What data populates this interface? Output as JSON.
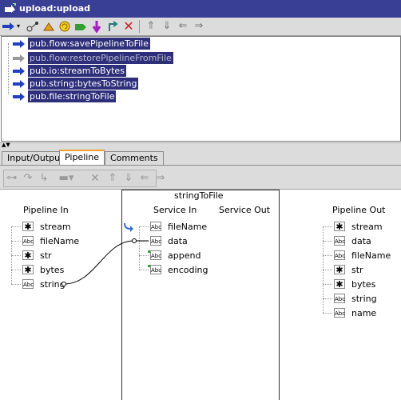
{
  "window": {
    "title": "upload:upload"
  },
  "toolbar_top": {
    "icons": [
      "step-in-icon",
      "dropdown-icon",
      "branch-icon",
      "repeat-icon",
      "loop-icon",
      "sequence-icon",
      "exit-icon",
      "down-icon",
      "exit-flow-icon",
      "delete-icon",
      "move-up-icon",
      "move-down-icon",
      "move-left-icon",
      "move-right-icon"
    ]
  },
  "flow": {
    "steps": [
      {
        "label": "pub.flow:savePipelineToFile",
        "disabled": false
      },
      {
        "label": "pub.flow:restorePipelineFromFile",
        "disabled": true
      },
      {
        "label": "pub.io:streamToBytes",
        "disabled": false
      },
      {
        "label": "pub.string:bytesToString",
        "disabled": false
      },
      {
        "label": "pub.file:stringToFile",
        "disabled": false
      }
    ]
  },
  "tabs": [
    {
      "label": "Input/Output",
      "active": false
    },
    {
      "label": "Pipeline",
      "active": true
    },
    {
      "label": "Comments",
      "active": false
    }
  ],
  "pipeline": {
    "service_name": "stringToFile",
    "pipeline_in_header": "Pipeline In",
    "service_in_header": "Service In",
    "service_out_header": "Service Out",
    "pipeline_out_header": "Pipeline Out",
    "pipeline_in": [
      {
        "name": "stream",
        "type": "object"
      },
      {
        "name": "fileName",
        "type": "string"
      },
      {
        "name": "str",
        "type": "object"
      },
      {
        "name": "bytes",
        "type": "object"
      },
      {
        "name": "string",
        "type": "string"
      }
    ],
    "service_in": [
      {
        "name": "fileName",
        "type": "string"
      },
      {
        "name": "data",
        "type": "string"
      },
      {
        "name": "append",
        "type": "string"
      },
      {
        "name": "encoding",
        "type": "string"
      }
    ],
    "pipeline_out": [
      {
        "name": "stream",
        "type": "object"
      },
      {
        "name": "data",
        "type": "string"
      },
      {
        "name": "fileName",
        "type": "string"
      },
      {
        "name": "str",
        "type": "object"
      },
      {
        "name": "bytes",
        "type": "object"
      },
      {
        "name": "string",
        "type": "string"
      },
      {
        "name": "name",
        "type": "string"
      }
    ]
  },
  "colors": {
    "title_bar": "#3a3f96",
    "selection": "#2e2f7a",
    "active_tab_accent": "#f0a030"
  }
}
